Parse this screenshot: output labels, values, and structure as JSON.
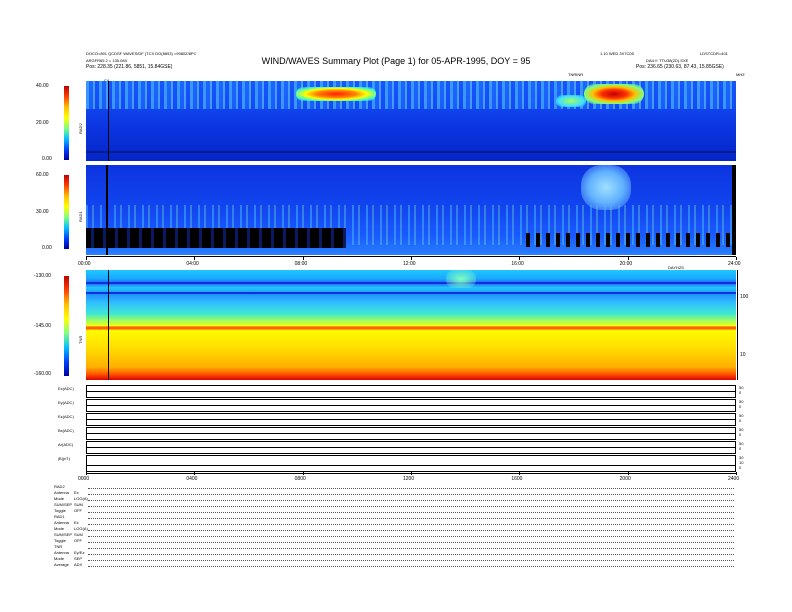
{
  "header": {
    "title": "WIND/WAVES Summary Plot (Page 1) for 05-APR-1995, DOY = 95",
    "left_line1": "DOCO=891 QCDSF WAVES/DF (TCX DO(8893) =9980Z/8PC",
    "left_line2": "ARGFR65 2 = 135.08X",
    "left_line3": "Pos: 228.35 (221.86, 5851, 15.84GSE)",
    "right_line1": "1.10 WED 3X7C05",
    "right_line2": "LDSTCDR=401",
    "right_line3": "DAILY: TTU38(2D).SXE",
    "right_line4": "Pos: 236.65 (230.63, 87.43, 15.85GSE)",
    "top_axis_label": "TNRINR",
    "mhz_label": "MHZ",
    "ca_marker": "CA"
  },
  "panels": {
    "rad2": {
      "name": "RAD2",
      "ticks": [
        "40.00",
        "20.00",
        "0.00"
      ]
    },
    "rad1": {
      "name": "RAD1",
      "ticks": [
        "60.00",
        "30.00",
        "0.00"
      ]
    },
    "tnr": {
      "name": "TNR",
      "ticks": [
        "-130.00",
        "-145.00",
        "-160.00"
      ],
      "right_ticks": [
        "100",
        "10"
      ],
      "right_label": "KHZ"
    },
    "time_axis_top": [
      "00:00",
      "04:00",
      "08:00",
      "12:00",
      "16:00",
      "20:00",
      "24:00"
    ],
    "time_axis_mid_label": "DAYHZS",
    "time_axis_bottom": [
      "0000",
      "0400",
      "0800",
      "1200",
      "1600",
      "2000",
      "2400"
    ]
  },
  "traces": [
    {
      "label": "Ex(ADC)",
      "right": [
        "50",
        "0"
      ]
    },
    {
      "label": "Ey(ADC)",
      "right": [
        "50",
        "0"
      ]
    },
    {
      "label": "Ez(ADC)",
      "right": [
        "50",
        "0"
      ]
    },
    {
      "label": "Bx(ADC)",
      "right": [
        "50",
        "0"
      ]
    },
    {
      "label": "Ar(ADC)",
      "right": [
        "50",
        "0"
      ]
    },
    {
      "label": "|B|(nT)",
      "right": [
        "30",
        "10",
        "0"
      ]
    }
  ],
  "modes": [
    {
      "k": "RAD2",
      "v": ""
    },
    {
      "k": "Antenna",
      "v": "Ex"
    },
    {
      "k": "Mode",
      "v": "LOG(A)"
    },
    {
      "k": "SUM/SEP",
      "v": "SUM"
    },
    {
      "k": "Toggle",
      "v": "OFF"
    },
    {
      "k": "RAD1",
      "v": ""
    },
    {
      "k": "Antenna",
      "v": "Ex"
    },
    {
      "k": "Mode",
      "v": "LOG(A)"
    },
    {
      "k": "SUM/SEP",
      "v": "SUM"
    },
    {
      "k": "Toggle",
      "v": "OFF"
    },
    {
      "k": "TNR",
      "v": ""
    },
    {
      "k": "Antenna",
      "v": "Ey/Ez"
    },
    {
      "k": "Mode",
      "v": "SEP"
    },
    {
      "k": "Average",
      "v": "ADX"
    }
  ],
  "chart_data": {
    "type": "heatmap",
    "title": "WIND/WAVES Summary Plot (Page 1) for 05-APR-1995, DOY = 95",
    "x_ticks": [
      "00:00",
      "04:00",
      "08:00",
      "12:00",
      "16:00",
      "20:00",
      "24:00"
    ],
    "xlim": [
      0,
      24
    ],
    "panels": [
      {
        "name": "RAD2",
        "zlim": [
          0,
          40
        ]
      },
      {
        "name": "RAD1",
        "zlim": [
          0,
          60
        ]
      },
      {
        "name": "TNR",
        "zlim": [
          -160,
          -130
        ]
      }
    ]
  }
}
